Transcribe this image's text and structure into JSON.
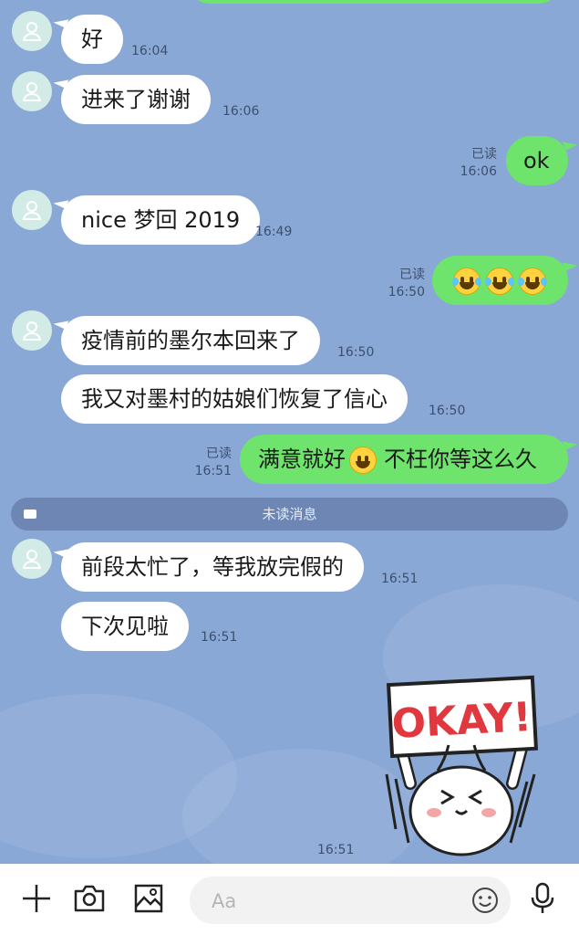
{
  "messages": [
    {
      "text": "好",
      "time": "16:04"
    },
    {
      "text": "进来了谢谢",
      "time": "16:06"
    },
    {
      "text": "ok",
      "time": "16:06",
      "read": "已读"
    },
    {
      "text": "nice 梦回 2019",
      "time": "16:49"
    },
    {
      "time": "16:50",
      "read": "已读"
    },
    {
      "text": "疫情前的墨尔本回来了",
      "time": "16:50"
    },
    {
      "text": "我又对墨村的姑娘们恢复了信心",
      "time": "16:50"
    },
    {
      "text_before": "满意就好",
      "text_after": "不枉你等这么久",
      "time": "16:51",
      "read": "已读"
    },
    {
      "text": "前段太忙了，等我放完假的",
      "time": "16:51"
    },
    {
      "text": "下次见啦",
      "time": "16:51"
    },
    {
      "time": "16:51"
    }
  ],
  "unread_divider": "未读消息",
  "sticker": {
    "text": "OKAY!"
  },
  "input": {
    "placeholder": "Aa"
  },
  "colors": {
    "background": "#8aa8d6",
    "incoming": "#ffffff",
    "outgoing": "#6fe46d"
  },
  "icons": [
    "plus-icon",
    "camera-icon",
    "image-icon",
    "emoji-icon",
    "microphone-icon"
  ]
}
